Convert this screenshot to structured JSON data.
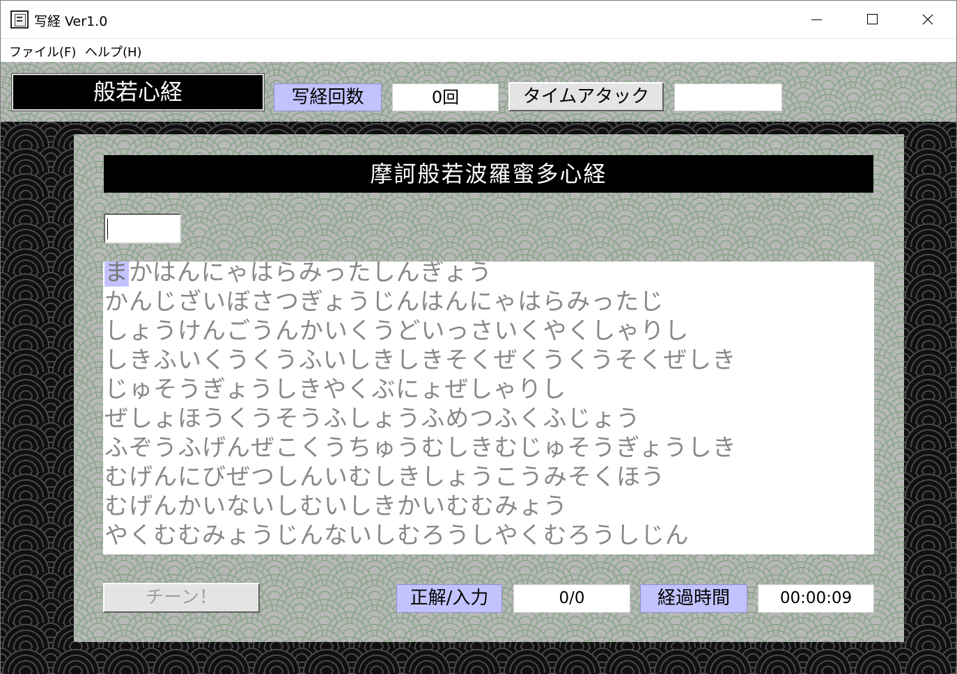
{
  "window": {
    "title": "写経 Ver1.0",
    "controls": [
      "minimize-icon",
      "maximize-icon",
      "close-icon"
    ]
  },
  "menu": {
    "file": "ファイル(F)",
    "help": "ヘルプ(H)"
  },
  "toolbar": {
    "sutra_name": "般若心経",
    "count_label": "写経回数",
    "count_value": "0回",
    "time_attack_label": "タイムアタック",
    "time_attack_value": ""
  },
  "main": {
    "heading": "摩訶般若波羅蜜多心経",
    "input_value": "",
    "highlighted_char": "ま",
    "lines": [
      "かはんにゃはらみったしんぎょう",
      "かんじざいぼさつぎょうじんはんにゃはらみったじ",
      "しょうけんごうんかいくうどいっさいくやくしゃりし",
      "しきふいくうくうふいしきしきそくぜくうくうそくぜしき",
      "じゅそうぎょうしきやくぶにょぜしゃりし",
      "ぜしょほうくうそうふしょうふめつふくふじょう",
      "ふぞうふげんぜこくうちゅうむしきむじゅそうぎょうしき",
      "むげんにびぜつしんいむしきしょうこうみそくほう",
      "むげんかいないしむいしきかいむむみょう",
      "やくむむみょうじんないしむろうしやくむろうしじん"
    ]
  },
  "footer": {
    "chin_button": "チーン！",
    "correct_label": "正解/入力",
    "correct_value": "0/0",
    "elapsed_label": "経過時間",
    "elapsed_value": "00:00:09"
  },
  "colors": {
    "label_bg": "#c2c2ff",
    "pattern_line": "#8fa88f",
    "text_gray": "#888888"
  }
}
